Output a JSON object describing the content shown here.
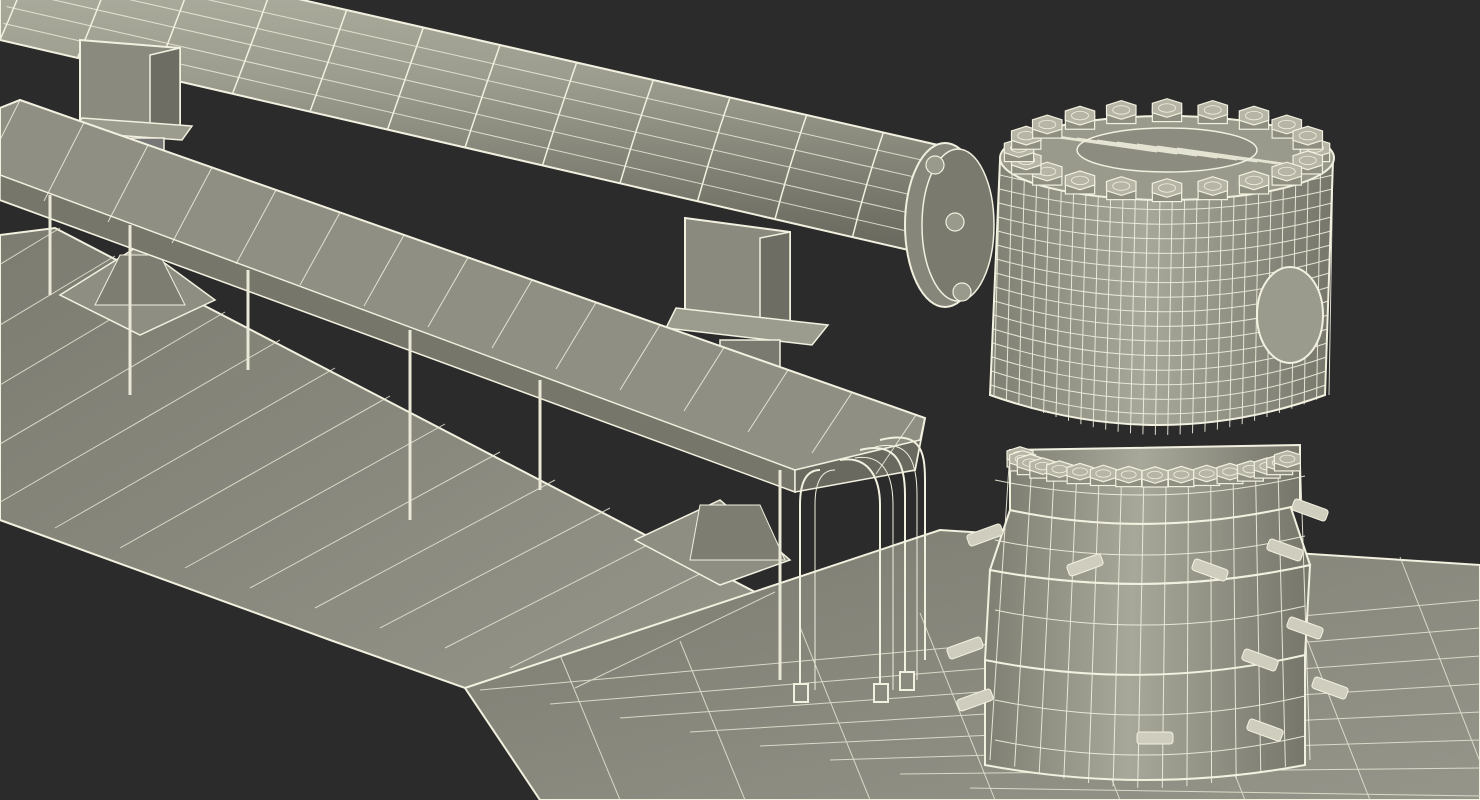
{
  "scene": {
    "subject": "wireframe-industrial-pipeline-model",
    "background_color": "#2b2b2b",
    "surface_color": "#8d8d80",
    "surface_light": "#a9a99b",
    "surface_dark": "#6e6e63",
    "wire_color": "#f2f0df",
    "components": [
      "main-pipe",
      "pipe-flange",
      "wellhead-tank",
      "tank-bolt-ring",
      "wellhead-base",
      "cable-tray",
      "pipe-support",
      "floor-slab",
      "small-pipes"
    ]
  }
}
